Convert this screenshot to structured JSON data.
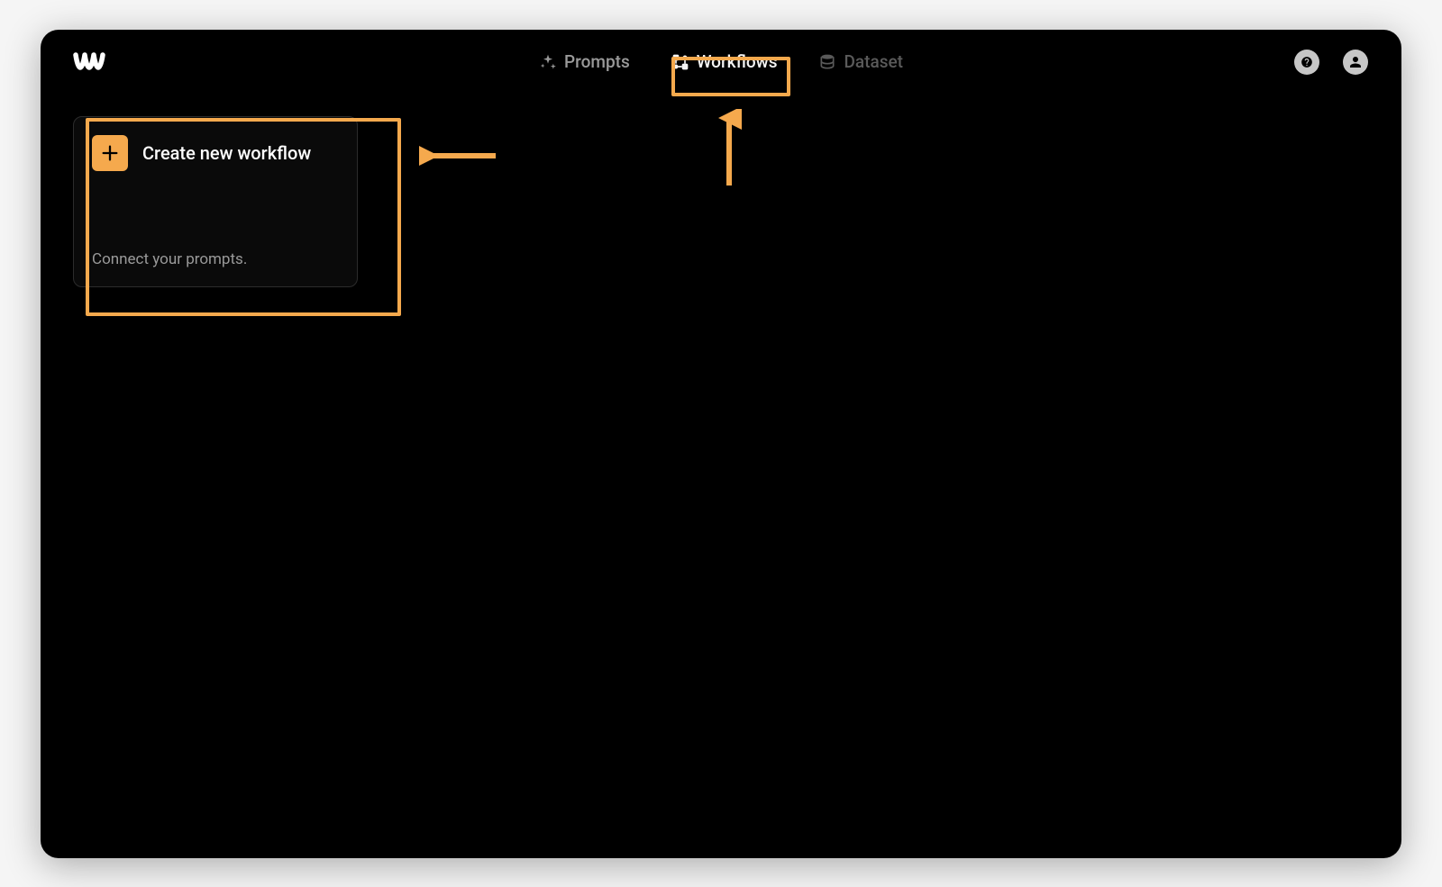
{
  "nav": {
    "tabs": [
      {
        "label": "Prompts",
        "icon": "sparkle-icon",
        "active": false,
        "dim": false
      },
      {
        "label": "Workflows",
        "icon": "workflow-icon",
        "active": true,
        "dim": false
      },
      {
        "label": "Dataset",
        "icon": "database-icon",
        "active": false,
        "dim": true
      }
    ]
  },
  "card": {
    "title": "Create new workflow",
    "subtitle": "Connect your prompts."
  },
  "colors": {
    "accent": "#f5a94d",
    "background": "#000000"
  }
}
